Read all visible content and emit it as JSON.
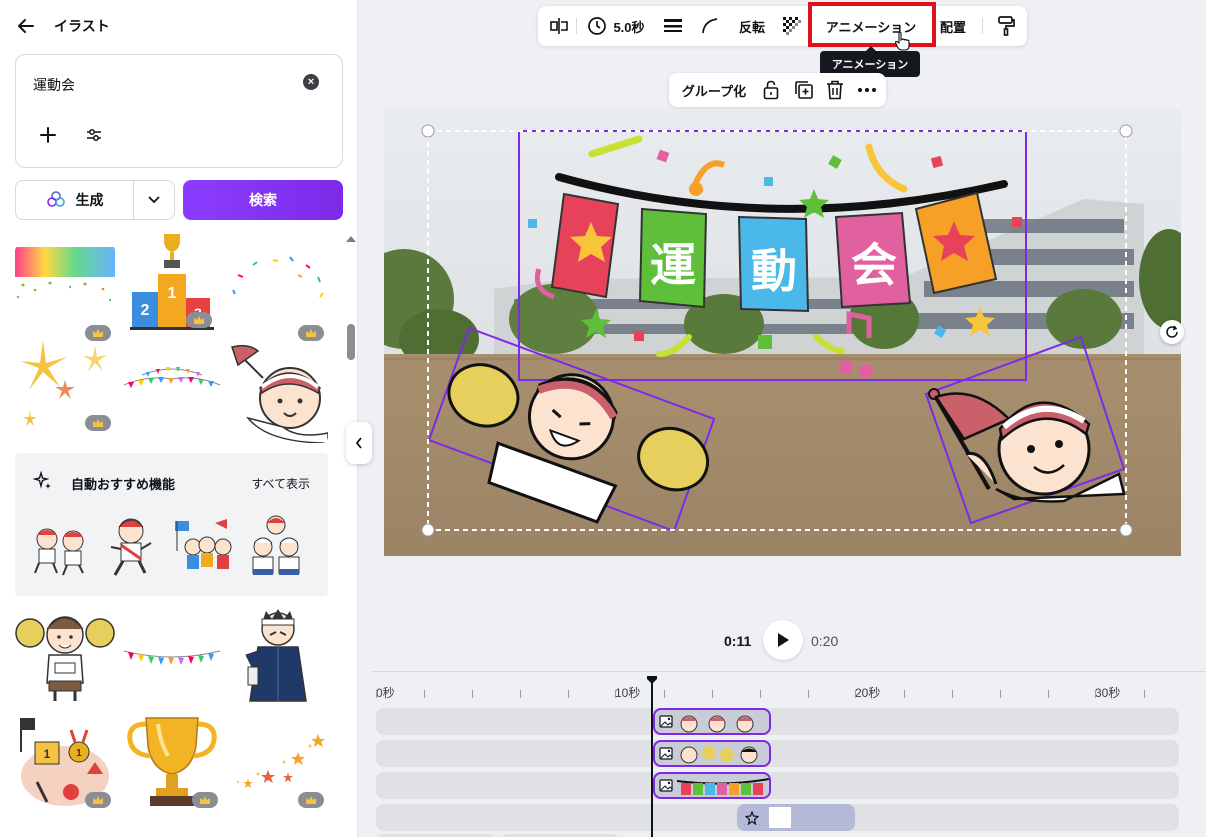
{
  "panel": {
    "title": "イラスト",
    "search_query": "運動会",
    "generate_label": "生成",
    "search_label": "検索",
    "auto_title": "自動おすすめ機能",
    "show_all": "すべて表示"
  },
  "toolbar": {
    "duration": "5.0秒",
    "flip": "反転",
    "animation": "アニメーション",
    "position": "配置",
    "tooltip": "アニメーション"
  },
  "group_bar": {
    "group_label": "グループ化"
  },
  "canvas": {
    "banner_chars": [
      "運",
      "動",
      "会"
    ]
  },
  "playback": {
    "current_time": "0:11",
    "total_time": "0:20"
  },
  "timeline": {
    "ruler_labels": [
      "0秒",
      "10秒",
      "20秒",
      "30秒"
    ]
  },
  "colors": {
    "accent": "#7d2ae8",
    "highlight": "#e0101c"
  },
  "icons": [
    "back-arrow-icon",
    "clear-icon",
    "plus-icon",
    "filter-icon",
    "sparkle-icon",
    "chevron-down-icon",
    "crown-icon",
    "chevron-left-icon",
    "flip-icon",
    "clock-icon",
    "lines-icon",
    "curve-icon",
    "transparency-icon",
    "paint-roller-icon",
    "lock-icon",
    "duplicate-icon",
    "trash-icon",
    "more-icon",
    "rotate-icon",
    "play-icon",
    "image-icon"
  ]
}
